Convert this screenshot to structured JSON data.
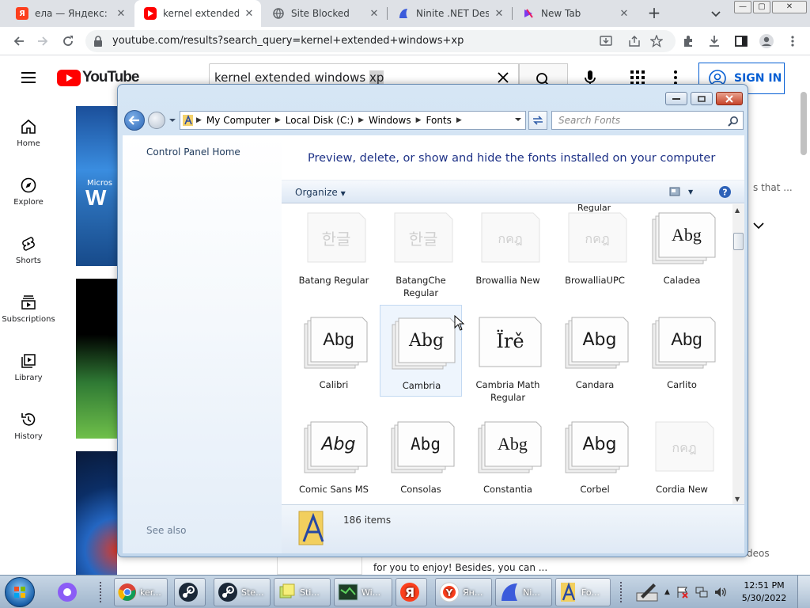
{
  "browser": {
    "tabs": [
      {
        "title": "ела — Яндекс: на",
        "icon": "yandex-icon",
        "active": false
      },
      {
        "title": "kernel extended w",
        "icon": "youtube-icon",
        "active": true
      },
      {
        "title": "Site Blocked",
        "icon": "globe-icon",
        "active": false
      },
      {
        "title": "Ninite .NET Deskt",
        "icon": "ninite-icon",
        "active": false
      },
      {
        "title": "New Tab",
        "icon": "newtab-icon",
        "active": false
      }
    ],
    "url": "youtube.com/results?search_query=kernel+extended+windows+xp"
  },
  "youtube": {
    "logo": "YouTube",
    "search_query": "kernel extended windows ",
    "search_query_selected": "xp",
    "sign_in": "SIGN IN",
    "guide": [
      {
        "label": "Home",
        "icon": "home-icon"
      },
      {
        "label": "Explore",
        "icon": "compass-icon"
      },
      {
        "label": "Shorts",
        "icon": "shorts-icon"
      },
      {
        "label": "Subscriptions",
        "icon": "subscriptions-icon"
      },
      {
        "label": "Library",
        "icon": "library-icon"
      },
      {
        "label": "History",
        "icon": "history-icon"
      }
    ],
    "snippet_right": "s that ...",
    "snippet_bottom_right": "deos",
    "snippet_bottom": "for you to enjoy! Besides, you can ...",
    "thumb_text": "Micros"
  },
  "explorer": {
    "breadcrumb": [
      "My Computer",
      "Local Disk (C:)",
      "Windows",
      "Fonts"
    ],
    "search_placeholder": "Search Fonts",
    "left_links": {
      "control_panel_home": "Control Panel Home",
      "see_also": "See also"
    },
    "heading": "Preview, delete, or show and hide the fonts installed on your computer",
    "organize": "Organize",
    "partial_label": "Regular",
    "fonts": [
      {
        "name": "Batang Regular",
        "glyph": "한글",
        "style": "faded"
      },
      {
        "name": "BatangChe Regular",
        "glyph": "한글",
        "style": "faded"
      },
      {
        "name": "Browallia New",
        "glyph": "กคฎ",
        "style": "faded"
      },
      {
        "name": "BrowalliaUPC",
        "glyph": "กคฎ",
        "style": "faded"
      },
      {
        "name": "Caladea",
        "glyph": "Abg",
        "style": "stack"
      },
      {
        "name": "Calibri",
        "glyph": "Abg",
        "style": "stack"
      },
      {
        "name": "Cambria",
        "glyph": "Abg",
        "style": "stack"
      },
      {
        "name": "Cambria Math Regular",
        "glyph": "Ïrě",
        "style": "single"
      },
      {
        "name": "Candara",
        "glyph": "Abg",
        "style": "stack"
      },
      {
        "name": "Carlito",
        "glyph": "Abg",
        "style": "stack"
      },
      {
        "name": "Comic Sans MS",
        "glyph": "Abg",
        "style": "stack"
      },
      {
        "name": "Consolas",
        "glyph": "Abg",
        "style": "stack"
      },
      {
        "name": "Constantia",
        "glyph": "Abg",
        "style": "stack"
      },
      {
        "name": "Corbel",
        "glyph": "Abg",
        "style": "stack"
      },
      {
        "name": "Cordia New",
        "glyph": "กคฎ",
        "style": "faded"
      }
    ],
    "item_count": "186 items"
  },
  "taskbar": {
    "items": [
      {
        "label": "ker...",
        "icon": "chrome-icon"
      },
      {
        "label": "",
        "icon": "steam-icon"
      },
      {
        "label": "Ste...",
        "icon": "steam-icon"
      },
      {
        "label": "Sti...",
        "icon": "sticky-notes-icon"
      },
      {
        "label": "Wi...",
        "icon": "window-icon"
      },
      {
        "label": "",
        "icon": "yandex-icon"
      },
      {
        "label": "Ян...",
        "icon": "yandex-browser-icon"
      },
      {
        "label": "Ni...",
        "icon": "ninite-icon"
      },
      {
        "label": "Fo...",
        "icon": "fonts-folder-icon"
      }
    ],
    "time": "12:51 PM",
    "date": "5/30/2022"
  }
}
